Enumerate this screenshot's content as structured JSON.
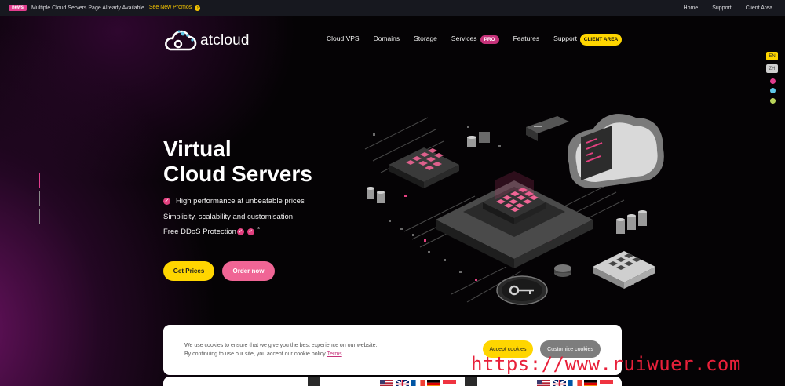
{
  "topbar": {
    "badge": "news",
    "notice": "Multiple Cloud Servers Page Already Available.",
    "promo_link": "See New Promos",
    "links": [
      "Home",
      "Support",
      "Client Area"
    ]
  },
  "header": {
    "logo_text": "atcloud",
    "nav": {
      "cloud_vps": "Cloud VPS",
      "domains": "Domains",
      "storage": "Storage",
      "services": "Services",
      "pro_badge": "PRO",
      "features": "Features",
      "support": "Support"
    },
    "client_area_button": "CLIENT AREA"
  },
  "side": {
    "lang_en": "EN",
    "lang_zh": "ZH",
    "theme_colors": [
      "#e23d8e",
      "#5ec8e8",
      "#b9d45a"
    ]
  },
  "hero": {
    "title_line1": "Virtual",
    "title_line2": "Cloud Servers",
    "features": [
      "High performance at unbeatable prices",
      "Simplicity, scalability and customisation",
      "Free DDoS Protection"
    ],
    "asterisk": "*",
    "get_prices_button": "Get Prices",
    "order_now_button": "Order now"
  },
  "cookie": {
    "line1": "We use cookies to ensure that we give you the best experience on our website.",
    "line2": "By continuing to use our site, you accept our cookie policy",
    "terms_link": "Terms",
    "accept_button": "Accept cookies",
    "customize_button": "Customize cookies"
  },
  "watermark": "https://www.ruiwuer.com",
  "colors": {
    "accent_yellow": "#ffd600",
    "accent_pink": "#f06595",
    "brand_magenta": "#c6327a"
  }
}
